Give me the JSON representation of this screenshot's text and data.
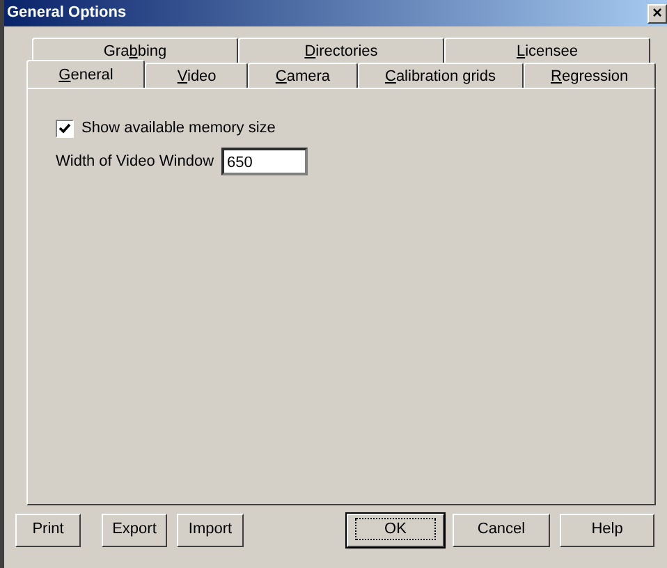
{
  "window": {
    "title": "General Options",
    "close": "×"
  },
  "tab_rows": [
    [
      {
        "before": "Gra",
        "key": "b",
        "after": "bing",
        "selected": false
      },
      {
        "key": "D",
        "after": "irectories",
        "selected": false
      },
      {
        "key": "L",
        "after": "icensee",
        "selected": false
      }
    ],
    [
      {
        "key": "G",
        "after": "eneral",
        "selected": true
      },
      {
        "key": "V",
        "after": "ideo",
        "selected": false
      },
      {
        "key": "C",
        "after": "amera",
        "selected": false
      },
      {
        "key": "C",
        "after": "alibration grids",
        "selected": false
      },
      {
        "key": "R",
        "after": "egression",
        "selected": false
      }
    ]
  ],
  "show_memory": {
    "label": "Show available memory size",
    "checked": true
  },
  "video_width": {
    "label": "Width of Video Window",
    "value": "650"
  },
  "buttons": [
    {
      "label": "Print",
      "default": false
    },
    {
      "label": "Export",
      "default": false
    },
    {
      "label": "Import",
      "default": false
    },
    {
      "label": "OK",
      "default": true
    },
    {
      "label": "Cancel",
      "default": false
    },
    {
      "label": "Help",
      "default": false
    }
  ]
}
